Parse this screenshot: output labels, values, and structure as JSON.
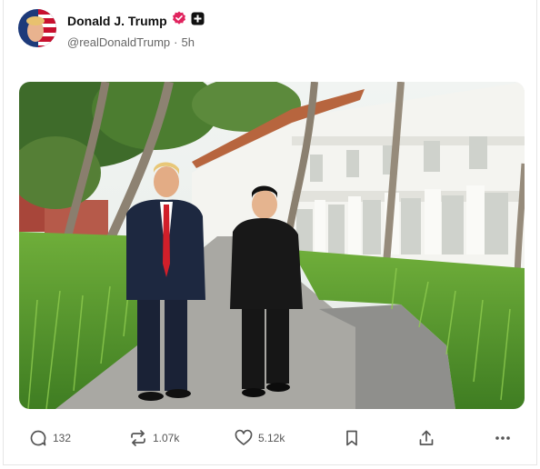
{
  "post": {
    "author_name": "Donald J. Trump",
    "handle": "@realDonaldTrump",
    "separator": "·",
    "time": "5h"
  },
  "icons": {
    "verified": "verified-badge-icon",
    "plus": "plus-badge-icon"
  },
  "actions": {
    "replies": "132",
    "reposts": "1.07k",
    "likes": "5.12k"
  },
  "colors": {
    "verified": "#e0245e",
    "muted_text": "#666666",
    "border": "#e6e6e6"
  }
}
